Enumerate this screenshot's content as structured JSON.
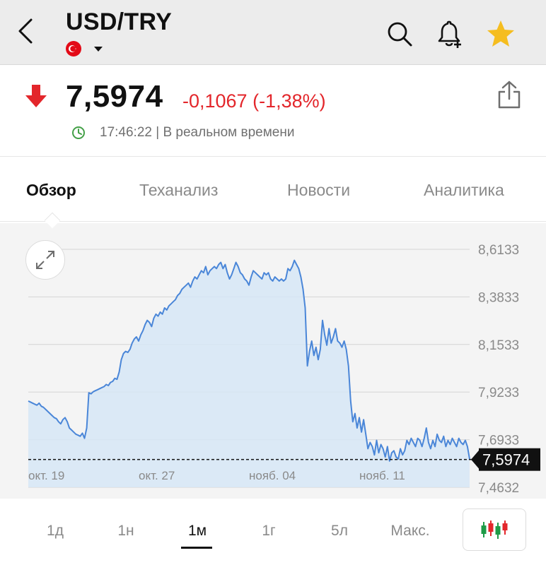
{
  "header": {
    "title": "USD/TRY",
    "back_icon": "chevron-left-icon",
    "search_icon": "search-icon",
    "alert_icon": "bell-plus-icon",
    "favorite_icon": "star-icon",
    "favorite_color": "#f5bd1f",
    "flag_icon": "turkey-flag-icon"
  },
  "quote": {
    "price": "7,5974",
    "change": "-0,1067 (-1,38%)",
    "time": "17:46:22 | В реальном времени",
    "direction": "down",
    "down_color": "#e3262b",
    "clock_color": "#43a047"
  },
  "tabs": [
    {
      "label": "Обзор",
      "active": true
    },
    {
      "label": "Теханализ",
      "active": false
    },
    {
      "label": "Новости",
      "active": false
    },
    {
      "label": "Аналитика",
      "active": false
    }
  ],
  "chart_data": {
    "type": "area",
    "y_ticks": [
      "8,6133",
      "8,3833",
      "8,1533",
      "7,9233",
      "7,6933",
      "7,4632"
    ],
    "x_ticks": [
      "окт. 19",
      "окт. 27",
      "нояб. 04",
      "нояб. 11"
    ],
    "ylim": [
      7.4632,
      8.6133
    ],
    "current_value": 7.5974,
    "current_label": "7,5974",
    "line_color": "#4a86d8",
    "fill_color": "#d6e6f6",
    "grid": true,
    "series": [
      {
        "values": [
          7.88,
          7.875,
          7.87,
          7.865,
          7.86,
          7.87,
          7.855,
          7.85,
          7.84,
          7.83,
          7.82,
          7.81,
          7.8,
          7.795,
          7.78,
          7.77,
          7.79,
          7.8,
          7.78,
          7.75,
          7.74,
          7.73,
          7.72,
          7.715,
          7.71,
          7.725,
          7.7,
          7.75,
          7.92,
          7.915,
          7.925,
          7.93,
          7.935,
          7.94,
          7.945,
          7.95,
          7.96,
          7.955,
          7.97,
          7.975,
          7.99,
          7.985,
          8.02,
          8.08,
          8.11,
          8.12,
          8.115,
          8.13,
          8.16,
          8.18,
          8.19,
          8.17,
          8.2,
          8.22,
          8.25,
          8.27,
          8.26,
          8.24,
          8.28,
          8.3,
          8.29,
          8.31,
          8.3,
          8.33,
          8.32,
          8.34,
          8.35,
          8.36,
          8.37,
          8.39,
          8.4,
          8.42,
          8.43,
          8.44,
          8.45,
          8.43,
          8.46,
          8.48,
          8.47,
          8.49,
          8.51,
          8.5,
          8.53,
          8.49,
          8.51,
          8.52,
          8.53,
          8.52,
          8.54,
          8.55,
          8.52,
          8.54,
          8.5,
          8.47,
          8.49,
          8.52,
          8.55,
          8.53,
          8.5,
          8.49,
          8.47,
          8.46,
          8.44,
          8.48,
          8.51,
          8.5,
          8.49,
          8.48,
          8.47,
          8.5,
          8.49,
          8.5,
          8.47,
          8.46,
          8.48,
          8.47,
          8.46,
          8.47,
          8.46,
          8.47,
          8.52,
          8.51,
          8.53,
          8.56,
          8.54,
          8.52,
          8.48,
          8.42,
          8.33,
          8.05,
          8.12,
          8.17,
          8.1,
          8.14,
          8.08,
          8.13,
          8.27,
          8.2,
          8.15,
          8.23,
          8.16,
          8.19,
          8.23,
          8.17,
          8.16,
          8.14,
          8.17,
          8.13,
          8.05,
          7.88,
          7.78,
          7.82,
          7.75,
          7.8,
          7.73,
          7.79,
          7.72,
          7.65,
          7.68,
          7.66,
          7.62,
          7.69,
          7.63,
          7.67,
          7.65,
          7.61,
          7.66,
          7.59,
          7.63,
          7.64,
          7.61,
          7.6,
          7.65,
          7.62,
          7.64,
          7.69,
          7.67,
          7.7,
          7.68,
          7.66,
          7.7,
          7.69,
          7.66,
          7.7,
          7.75,
          7.68,
          7.65,
          7.69,
          7.66,
          7.72,
          7.69,
          7.68,
          7.71,
          7.66,
          7.69,
          7.67,
          7.7,
          7.68,
          7.66,
          7.7,
          7.68,
          7.67,
          7.69,
          7.66,
          7.6
        ]
      }
    ]
  },
  "ranges": [
    {
      "label": "1д",
      "active": false
    },
    {
      "label": "1н",
      "active": false
    },
    {
      "label": "1м",
      "active": true
    },
    {
      "label": "1г",
      "active": false
    },
    {
      "label": "5л",
      "active": false
    },
    {
      "label": "Макс.",
      "active": false
    }
  ],
  "candle_icon": "candlestick-chart-icon",
  "expand_icon": "expand-diagonal-icon",
  "share_icon": "share-icon"
}
